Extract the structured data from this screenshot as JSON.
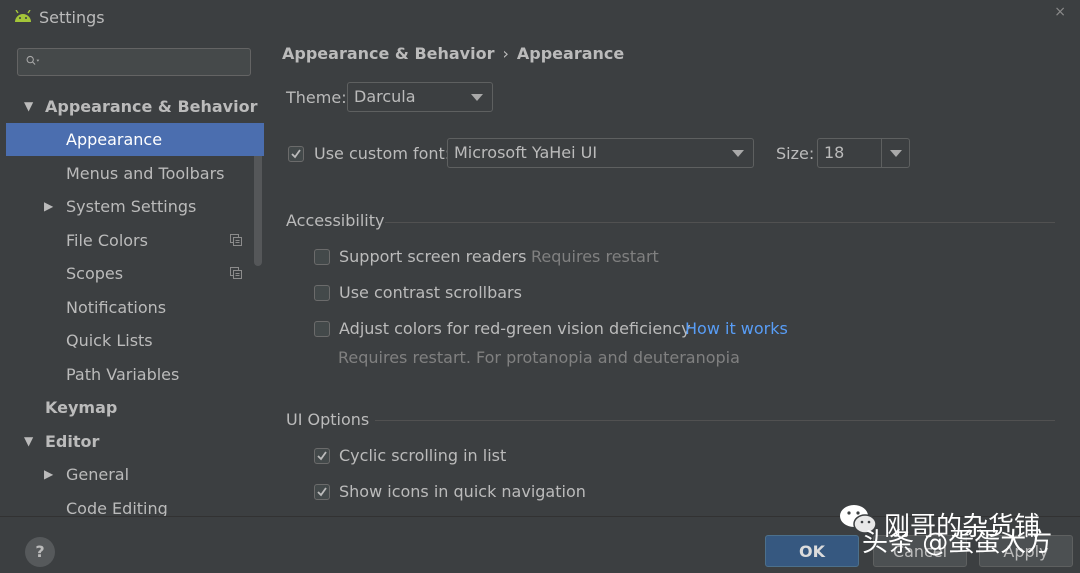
{
  "window": {
    "title": "Settings",
    "close_glyph": "×"
  },
  "search": {
    "placeholder": ""
  },
  "tree": {
    "items": [
      {
        "label": "Appearance & Behavior"
      },
      {
        "label": "Appearance"
      },
      {
        "label": "Menus and Toolbars"
      },
      {
        "label": "System Settings"
      },
      {
        "label": "File Colors"
      },
      {
        "label": "Scopes"
      },
      {
        "label": "Notifications"
      },
      {
        "label": "Quick Lists"
      },
      {
        "label": "Path Variables"
      },
      {
        "label": "Keymap"
      },
      {
        "label": "Editor"
      },
      {
        "label": "General"
      },
      {
        "label": "Code Editing"
      }
    ]
  },
  "breadcrumb": {
    "parent": "Appearance & Behavior",
    "separator": "›",
    "current": "Appearance"
  },
  "theme": {
    "label": "Theme:",
    "value": "Darcula"
  },
  "font": {
    "checkbox_label": "Use custom font:",
    "checked": true,
    "value": "Microsoft YaHei UI",
    "size_label": "Size:",
    "size_value": "18"
  },
  "accessibility": {
    "title": "Accessibility",
    "screen_readers": {
      "label": "Support screen readers",
      "hint": "Requires restart",
      "checked": false
    },
    "contrast_scrollbars": {
      "label": "Use contrast scrollbars",
      "checked": false
    },
    "color_deficiency": {
      "label": "Adjust colors for red-green vision deficiency",
      "link": "How it works",
      "hint": "Requires restart. For protanopia and deuteranopia",
      "checked": false
    }
  },
  "ui_options": {
    "title": "UI Options",
    "cyclic_scrolling": {
      "label": "Cyclic scrolling in list",
      "checked": true
    },
    "show_icons": {
      "label": "Show icons in quick navigation",
      "checked": true
    }
  },
  "footer": {
    "help": "?",
    "ok": "OK",
    "cancel": "Cancel",
    "apply": "Apply"
  },
  "watermark": {
    "line1": "刚哥的杂货铺",
    "line2": "头条 @蛋蛋大方"
  },
  "colors": {
    "accent": "#4b6eaf",
    "link": "#589df6",
    "background": "#3c3f41",
    "android_green": "#a4c639"
  }
}
